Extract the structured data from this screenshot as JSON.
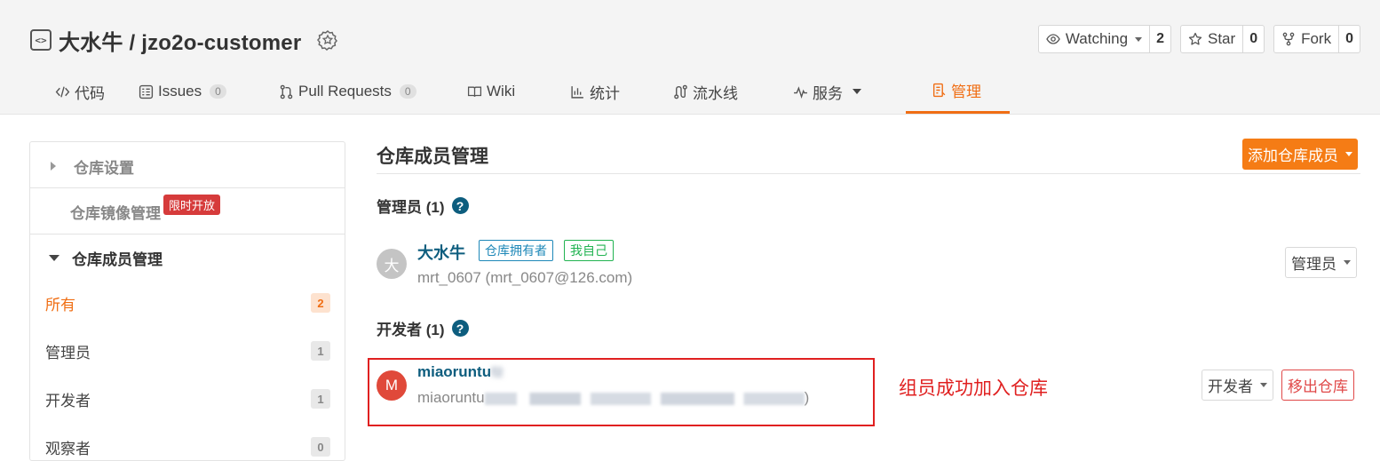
{
  "repo": {
    "owner": "大水牛",
    "separator": "/",
    "name": "jzo2o-customer",
    "actions": [
      {
        "id": "watch",
        "label": "Watching",
        "count": "2",
        "icon": "eye-icon",
        "dropdown": true
      },
      {
        "id": "star",
        "label": "Star",
        "count": "0",
        "icon": "star-icon",
        "dropdown": false
      },
      {
        "id": "fork",
        "label": "Fork",
        "count": "0",
        "icon": "fork-icon",
        "dropdown": false
      }
    ]
  },
  "tabs": [
    {
      "label": "代码",
      "icon": "code-icon",
      "count": null,
      "active": false
    },
    {
      "label": "Issues",
      "icon": "issues-icon",
      "count": "0",
      "active": false
    },
    {
      "label": "Pull Requests",
      "icon": "pull-request-icon",
      "count": "0",
      "active": false
    },
    {
      "label": "Wiki",
      "icon": "book-icon",
      "count": null,
      "active": false
    },
    {
      "label": "统计",
      "icon": "bar-chart-icon",
      "count": null,
      "active": false
    },
    {
      "label": "流水线",
      "icon": "pipeline-icon",
      "count": null,
      "active": false
    },
    {
      "label": "服务",
      "icon": "pulse-icon",
      "count": null,
      "active": false,
      "dropdown": true
    },
    {
      "label": "管理",
      "icon": "manage-icon",
      "count": null,
      "active": true
    }
  ],
  "sidebar": {
    "repo_settings": "仓库设置",
    "mirror_management": "仓库镜像管理",
    "limited_badge": "限时开放",
    "member_management": "仓库成员管理",
    "filters": [
      {
        "label": "所有",
        "count": "2",
        "active": true
      },
      {
        "label": "管理员",
        "count": "1",
        "active": false
      },
      {
        "label": "开发者",
        "count": "1",
        "active": false
      },
      {
        "label": "观察者",
        "count": "0",
        "active": false
      }
    ]
  },
  "main": {
    "title": "仓库成员管理",
    "add_button": "添加仓库成员",
    "help_icon": "question-icon",
    "sections": [
      {
        "heading": "管理员 (1)",
        "members": [
          {
            "avatar": "大",
            "name": "大水牛",
            "email": "mrt_0607 (mrt_0607@126.com)",
            "tags": [
              "仓库拥有者",
              "我自己"
            ],
            "role": "管理员",
            "remove": null,
            "avatar_color": "#c4c4c4"
          }
        ]
      },
      {
        "heading": "开发者 (1)",
        "members": [
          {
            "avatar": "M",
            "name": "miaoruntu",
            "name_tail": "f2",
            "email_prefix": "miaoruntu",
            "email_suffix": ")",
            "role": "开发者",
            "remove": "移出仓库",
            "avatar_color": "#e0493a"
          }
        ]
      }
    ],
    "annotation": "组员成功加入仓库"
  },
  "colors": {
    "accent": "#f06e14",
    "link": "#0d5d7e",
    "danger": "#e02020"
  }
}
